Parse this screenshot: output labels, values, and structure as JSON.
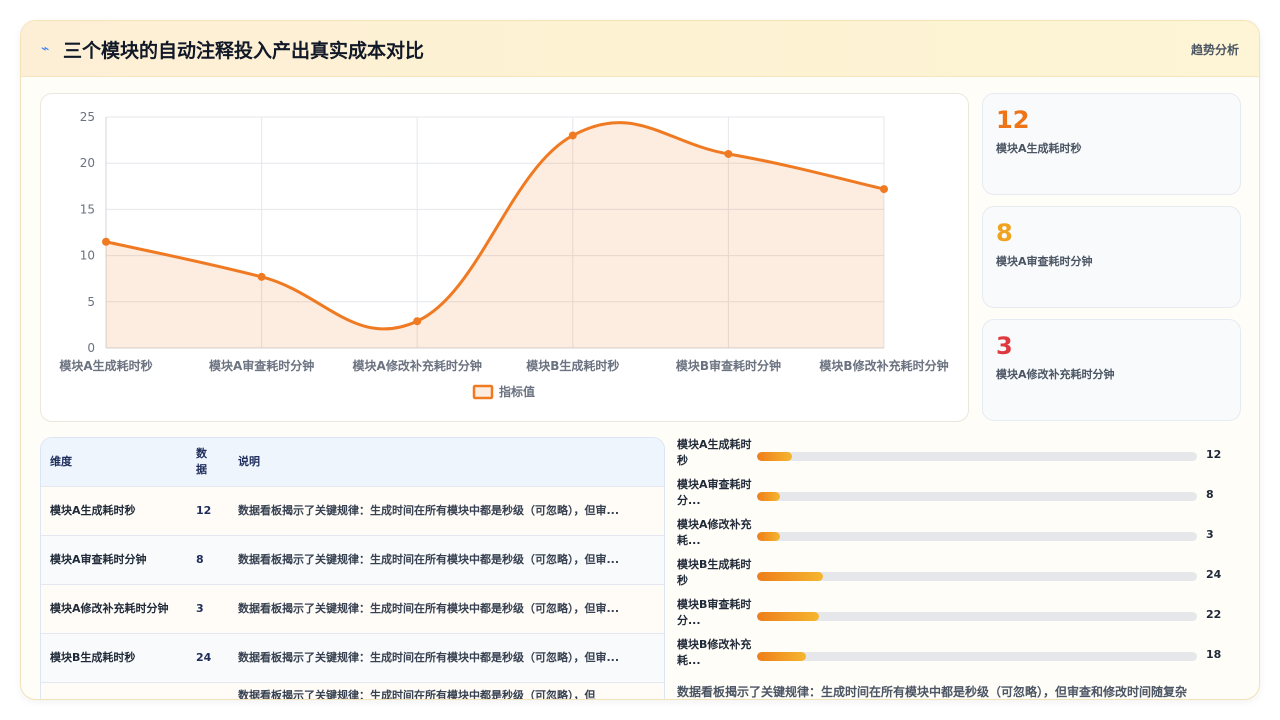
{
  "header": {
    "icon": "lightning-icon",
    "title": "三个模块的自动注释投入产出真实成本对比",
    "action_label": "趋势分析"
  },
  "chart_data": {
    "type": "line",
    "categories": [
      "模块A生成耗时秒",
      "模块A审查耗时分钟",
      "模块A修改补充耗时分钟",
      "模块B生成耗时秒",
      "模块B审查耗时分钟",
      "模块B修改补充耗时分钟"
    ],
    "series": [
      {
        "name": "指标值",
        "values": [
          11.5,
          7.7,
          2.9,
          23,
          21,
          17.2
        ],
        "color": "#ef7a22"
      }
    ],
    "ylim": [
      0,
      25
    ],
    "yticks": [
      0,
      5,
      10,
      15,
      20,
      25
    ],
    "grid": true,
    "legend_position": "bottom",
    "xlabel": "",
    "ylabel": ""
  },
  "kpis": [
    {
      "value": "12",
      "label": "模块A生成耗时秒",
      "color": "#ee7418"
    },
    {
      "value": "8",
      "label": "模块A审查耗时分钟",
      "color": "#f0a31f"
    },
    {
      "value": "3",
      "label": "模块A修改补充耗时分钟",
      "color": "#e0383f"
    }
  ],
  "table": {
    "headers": {
      "dim": "维度",
      "data": "数据",
      "desc": "说明"
    },
    "rows": [
      {
        "dim": "模块A生成耗时秒",
        "value": "12",
        "desc": "数据看板揭示了关键规律：生成时间在所有模块中都是秒级（可忽略），但审..."
      },
      {
        "dim": "模块A审查耗时分钟",
        "value": "8",
        "desc": "数据看板揭示了关键规律：生成时间在所有模块中都是秒级（可忽略），但审..."
      },
      {
        "dim": "模块A修改补充耗时分钟",
        "value": "3",
        "desc": "数据看板揭示了关键规律：生成时间在所有模块中都是秒级（可忽略），但审..."
      },
      {
        "dim": "模块B生成耗时秒",
        "value": "24",
        "desc": "数据看板揭示了关键规律：生成时间在所有模块中都是秒级（可忽略），但审..."
      },
      {
        "dim": "",
        "value": "",
        "desc": "数据看板揭示了关键规律：生成时间在所有模块中都是秒级（可忽略），但"
      }
    ]
  },
  "bars": {
    "max": 153,
    "items": [
      {
        "label": "模块A生成耗时秒",
        "value": 12,
        "display": "12"
      },
      {
        "label": "模块A审查耗时分...",
        "value": 8,
        "display": "8"
      },
      {
        "label": "模块A修改补充耗...",
        "value": 8,
        "display": "3"
      },
      {
        "label": "模块B生成耗时秒",
        "value": 23,
        "display": "24"
      },
      {
        "label": "模块B审查耗时分...",
        "value": 21.5,
        "display": "22"
      },
      {
        "label": "模块B修改补充耗...",
        "value": 17,
        "display": "18"
      }
    ]
  },
  "summary": "数据看板揭示了关键规律：生成时间在所有模块中都是秒级（可忽略），但审查和修改时间随复杂"
}
